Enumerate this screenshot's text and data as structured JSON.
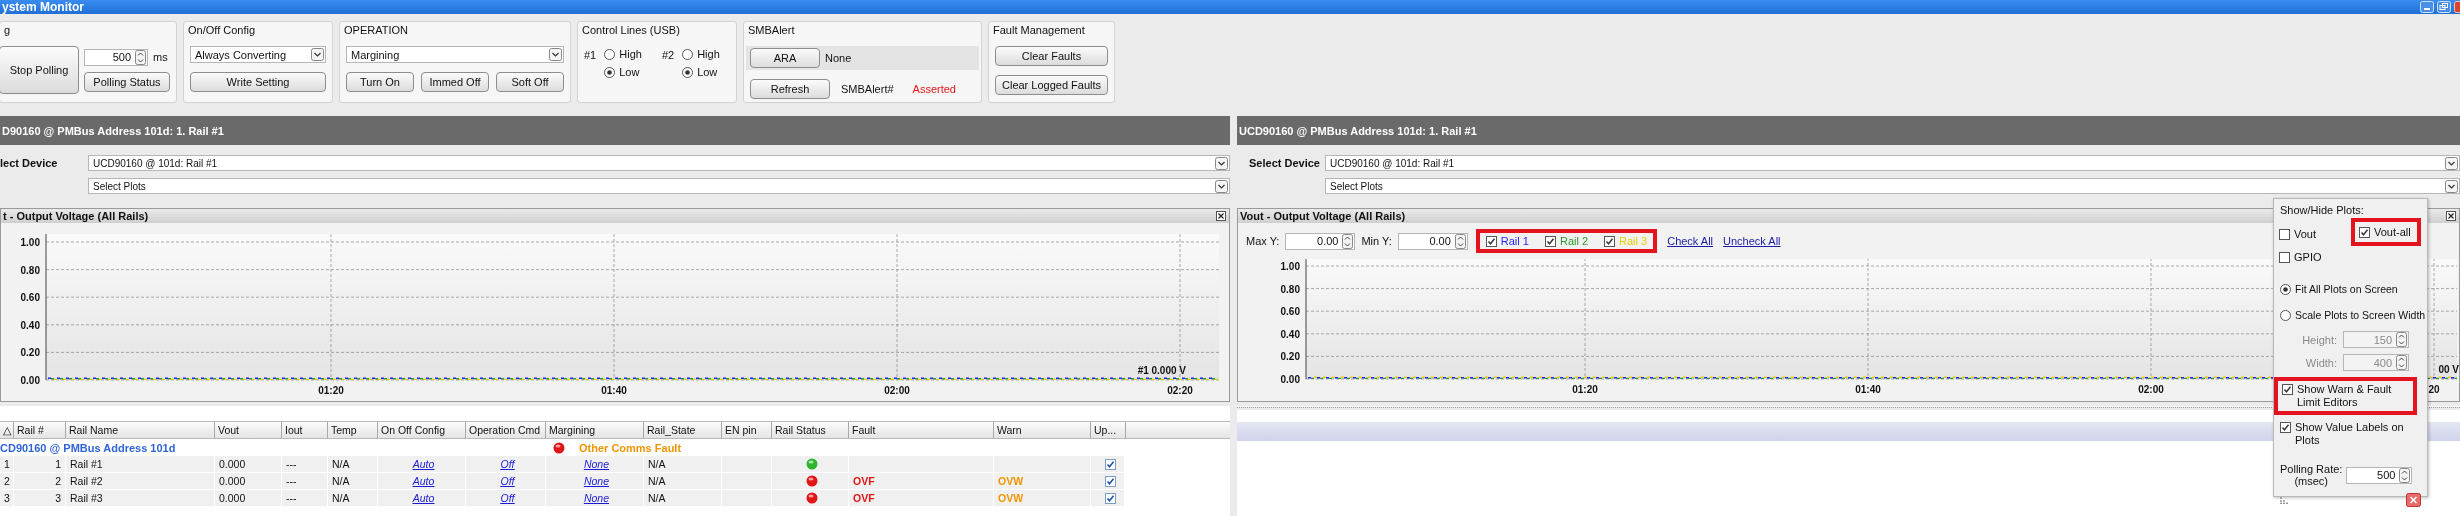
{
  "window": {
    "title": "ystem Monitor"
  },
  "toolbar": {
    "polling": {
      "title": "g",
      "stop_button": "Stop Polling",
      "interval": "500",
      "unit": "ms",
      "status_button": "Polling Status"
    },
    "on_off_config": {
      "title": "On/Off Config",
      "value": "Always Converting",
      "button": "Write Setting"
    },
    "operation": {
      "title": "OPERATION",
      "value": "Margining",
      "buttons": [
        "Turn On",
        "Immed Off",
        "Soft Off"
      ]
    },
    "control_lines": {
      "title": "Control Lines (USB)",
      "lines": [
        {
          "label": "#1",
          "options": [
            {
              "label": "High",
              "selected": false
            },
            {
              "label": "Low",
              "selected": true
            }
          ]
        },
        {
          "label": "#2",
          "options": [
            {
              "label": "High",
              "selected": false
            },
            {
              "label": "Low",
              "selected": true
            }
          ]
        }
      ]
    },
    "smbalert": {
      "title": "SMBAlert",
      "ara_button": "ARA",
      "ara_result": "None",
      "refresh_button": "Refresh",
      "signal_label": "SMBAlert#",
      "signal_state": "Asserted"
    },
    "fault_management": {
      "title": "Fault Management",
      "buttons": [
        "Clear Faults",
        "Clear Logged Faults"
      ]
    }
  },
  "panels": [
    {
      "header": "D90160 @ PMBus Address 101d: 1. Rail #1",
      "device_label": "lect Device",
      "device": "UCD90160 @ 101d: Rail #1",
      "plots": "Select Plots",
      "chart_title": "t - Output Voltage (All Rails)",
      "value_label": "#1 0.000 V",
      "y_labels": [
        "1.00",
        "0.80",
        "0.60",
        "0.40",
        "0.20",
        "0.00"
      ],
      "x_labels": [
        "01:20",
        "01:40",
        "02:00",
        "02:20"
      ]
    },
    {
      "header": "UCD90160 @ PMBus Address 101d: 1. Rail #1",
      "device_label": "Select Device",
      "device": "UCD90160 @ 101d: Rail #1",
      "plots": "Select Plots",
      "chart_title": "Vout - Output Voltage (All Rails)",
      "value_label": "00 V",
      "controls": {
        "max_label": "Max Y:",
        "max": "0.00",
        "min_label": "Min Y:",
        "min": "0.00",
        "highlighted": true,
        "rails": [
          {
            "label": "Rail 1",
            "checked": true,
            "color": "#1f1fff"
          },
          {
            "label": "Rail 2",
            "checked": true,
            "color": "#2a9a2a"
          },
          {
            "label": "Rail 3",
            "checked": true,
            "color": "#e6cf00"
          }
        ],
        "links": [
          "Check All",
          "Uncheck All"
        ]
      },
      "y_labels": [
        "1.00",
        "0.80",
        "0.60",
        "0.40",
        "0.20",
        "0.00"
      ],
      "x_labels": [
        "01:20",
        "01:40",
        "02:00",
        "20"
      ]
    }
  ],
  "plot_options": {
    "title": "Show/Hide Plots:",
    "plots": [
      {
        "label": "Vout",
        "checked": false,
        "highlighted": false
      },
      {
        "label": "Vout-all",
        "checked": true,
        "highlighted": true
      },
      {
        "label": "GPIO",
        "checked": false,
        "highlighted": false
      }
    ],
    "fit_modes": [
      {
        "label": "Fit All Plots on Screen",
        "selected": true
      },
      {
        "label": "Scale Plots to Screen Width",
        "selected": false
      }
    ],
    "sizes": [
      {
        "label": "Height:",
        "value": "150",
        "disabled": true
      },
      {
        "label": "Width:",
        "value": "400",
        "disabled": true
      }
    ],
    "options": [
      {
        "label": "Show Warn & Fault Limit Editors",
        "checked": true,
        "highlighted": true
      },
      {
        "label": "Show Value Labels on Plots",
        "checked": true,
        "highlighted": false
      }
    ],
    "polling_label": "Polling Rate:",
    "polling_unit": "(msec)",
    "polling_rate": "500"
  },
  "table": {
    "columns": [
      "△",
      "Rail #",
      "Rail Name",
      "Vout",
      "Iout",
      "Temp",
      "On Off Config",
      "Operation Cmd",
      "Margining",
      "Rail_State",
      "EN pin",
      "Rail Status",
      "Fault",
      "Warn",
      "Up..."
    ],
    "group": {
      "label": "CD90160 @ PMBus Address 101d",
      "color": "#e01515",
      "status_text": "Other Comms Fault"
    },
    "rows": [
      {
        "cells": [
          {
            "kind": "text",
            "text": "1"
          },
          {
            "kind": "num",
            "text": "1"
          },
          {
            "kind": "text",
            "text": "Rail #1"
          },
          {
            "kind": "text",
            "text": "0.000"
          },
          {
            "kind": "text",
            "text": "---"
          },
          {
            "kind": "text",
            "text": "N/A"
          },
          {
            "kind": "link",
            "text": "Auto"
          },
          {
            "kind": "link",
            "text": "Off"
          },
          {
            "kind": "link",
            "text": "None"
          },
          {
            "kind": "text",
            "text": "N/A"
          },
          {
            "kind": "blank"
          },
          {
            "kind": "status",
            "color": "#2fb52f"
          },
          {
            "kind": "blank"
          },
          {
            "kind": "blank"
          },
          {
            "kind": "check",
            "checked": true
          }
        ]
      },
      {
        "cells": [
          {
            "kind": "text",
            "text": "2"
          },
          {
            "kind": "num",
            "text": "2"
          },
          {
            "kind": "text",
            "text": "Rail #2"
          },
          {
            "kind": "text",
            "text": "0.000"
          },
          {
            "kind": "text",
            "text": "---"
          },
          {
            "kind": "text",
            "text": "N/A"
          },
          {
            "kind": "link",
            "text": "Auto"
          },
          {
            "kind": "link",
            "text": "Off"
          },
          {
            "kind": "link",
            "text": "None"
          },
          {
            "kind": "text",
            "text": "N/A"
          },
          {
            "kind": "blank"
          },
          {
            "kind": "status",
            "color": "#e01515"
          },
          {
            "kind": "fault",
            "text": "OVF"
          },
          {
            "kind": "warn",
            "text": "OVW"
          },
          {
            "kind": "check",
            "checked": true
          }
        ]
      },
      {
        "cells": [
          {
            "kind": "text",
            "text": "3"
          },
          {
            "kind": "num",
            "text": "3"
          },
          {
            "kind": "text",
            "text": "Rail #3"
          },
          {
            "kind": "text",
            "text": "0.000"
          },
          {
            "kind": "text",
            "text": "---"
          },
          {
            "kind": "text",
            "text": "N/A"
          },
          {
            "kind": "link",
            "text": "Auto"
          },
          {
            "kind": "link",
            "text": "Off"
          },
          {
            "kind": "link",
            "text": "None"
          },
          {
            "kind": "text",
            "text": "N/A"
          },
          {
            "kind": "blank"
          },
          {
            "kind": "status",
            "color": "#e01515"
          },
          {
            "kind": "fault",
            "text": "OVF"
          },
          {
            "kind": "warn",
            "text": "OVW"
          },
          {
            "kind": "check",
            "checked": true
          }
        ]
      }
    ]
  }
}
